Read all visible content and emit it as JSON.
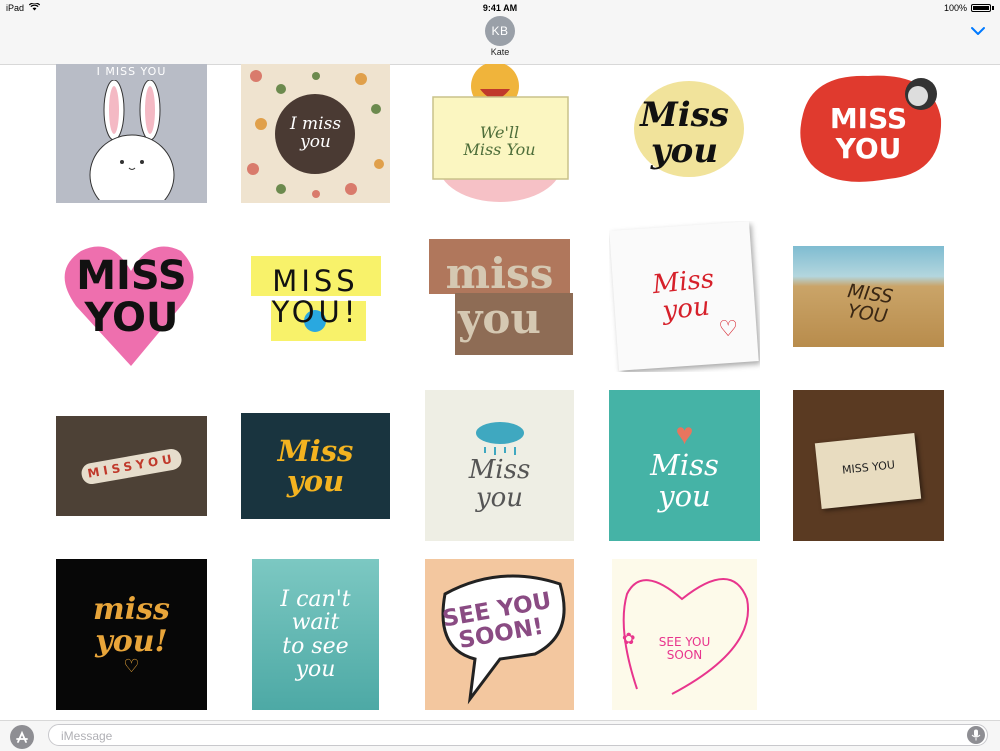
{
  "status_bar": {
    "device": "iPad",
    "time": "9:41 AM",
    "battery": "100%"
  },
  "header": {
    "avatar_initials": "KB",
    "contact_name": "Kate"
  },
  "stickers": [
    {
      "text": "I MISS YOU"
    },
    {
      "text": "I miss\nyou"
    },
    {
      "text": "We'll\nMiss You"
    },
    {
      "text": "Miss\nyou"
    },
    {
      "text": "MISS\nYOU"
    },
    {
      "text": "MISS\nYOU"
    },
    {
      "text": "MISS\nYOU!"
    },
    {
      "text": "miss\nyou"
    },
    {
      "text": "Miss\nyou"
    },
    {
      "text": "MISS\nYOU"
    },
    {
      "text": "MISSYOU"
    },
    {
      "text": "Miss\nyou"
    },
    {
      "text": "Miss\nyou"
    },
    {
      "text": "Miss\nyou"
    },
    {
      "text": "MISS YOU"
    },
    {
      "text": "miss\nyou!"
    },
    {
      "text": "I can't\nwait\nto see\nyou"
    },
    {
      "text": "SEE YOU\nSOON!"
    },
    {
      "text": "SEE YOU\nSOON"
    }
  ],
  "compose": {
    "placeholder": "iMessage"
  },
  "colors": {
    "accent": "#007aff",
    "header_bg": "#f6f6f6"
  }
}
